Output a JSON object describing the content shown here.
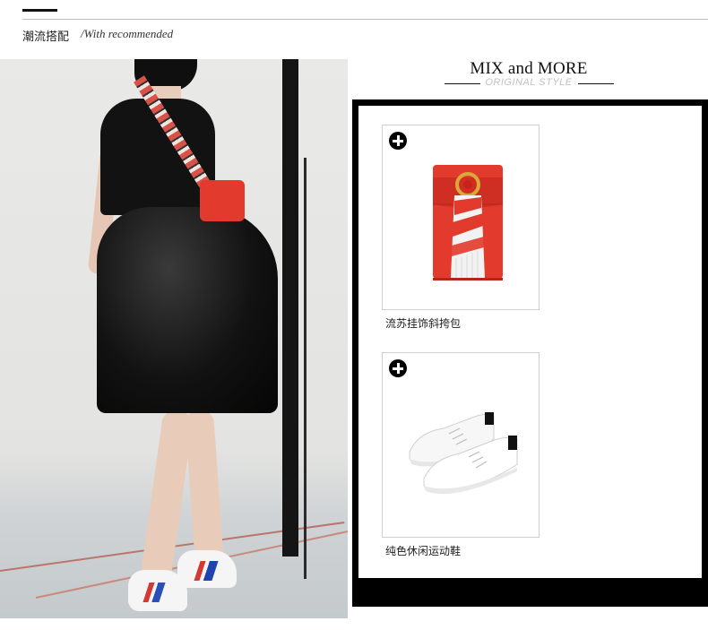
{
  "header": {
    "title": "潮流搭配",
    "subtitle": "/With recommended"
  },
  "mix": {
    "title": "MIX and MORE",
    "subtitle": "ORIGINAL STYLE"
  },
  "products": [
    {
      "name": "流苏挂饰斜挎包",
      "image": "red-tassel-crossbody-bag",
      "badge_icon": "plus-circle-icon"
    },
    {
      "name": "纯色休闲运动鞋",
      "image": "white-casual-sneakers",
      "badge_icon": "plus-circle-icon"
    }
  ],
  "colors": {
    "accent": "#000000",
    "bag_red": "#e23a2c",
    "divider": "#bdbdbd",
    "subtitle_gray": "#c2c2c2"
  }
}
